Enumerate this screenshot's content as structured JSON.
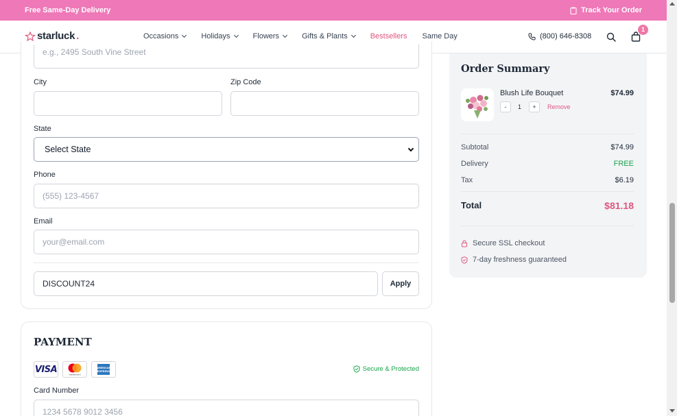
{
  "promo": {
    "left_text": "Free Same-Day Delivery",
    "track_label": "Track Your Order"
  },
  "header": {
    "logo": "starluck",
    "logo_dot": ".",
    "nav": [
      {
        "label": "Occasions",
        "dropdown": true
      },
      {
        "label": "Holidays",
        "dropdown": true
      },
      {
        "label": "Flowers",
        "dropdown": true
      },
      {
        "label": "Gifts & Plants",
        "dropdown": true
      },
      {
        "label": "Bestsellers",
        "dropdown": false,
        "accent": true
      },
      {
        "label": "Same Day",
        "dropdown": false
      }
    ],
    "phone": "(800) 646-8308",
    "cart_count": "1"
  },
  "address": {
    "street_placeholder": "e.g., 2495 South Vine Street",
    "city_label": "City",
    "zip_label": "Zip Code",
    "state_label": "State",
    "state_value": "Select State",
    "phone_label": "Phone",
    "phone_placeholder": "(555) 123-4567",
    "email_label": "Email",
    "email_placeholder": "your@email.com",
    "discount_value": "DISCOUNT24",
    "apply_label": "Apply"
  },
  "payment": {
    "title": "PAYMENT",
    "cards": [
      "visa",
      "mastercard",
      "amex"
    ],
    "visa_text": "VISA",
    "mastercard_text": "mastercard",
    "amex_text": "AMERICAN EXPRESS",
    "secure_label": "Secure & Protected",
    "card_number_label": "Card Number",
    "card_number_placeholder": "1234 5678 9012 3456"
  },
  "summary": {
    "title": "Order Summary",
    "item_name": "Blush Life Bouquet",
    "item_price": "$74.99",
    "qty_minus": "-",
    "qty": "1",
    "qty_plus": "+",
    "remove": "Remove",
    "subtotal_label": "Subtotal",
    "subtotal": "$74.99",
    "delivery_label": "Delivery",
    "delivery": "FREE",
    "tax_label": "Tax",
    "tax": "$6.19",
    "total_label": "Total",
    "total": "$81.18",
    "trust_ssl": "Secure SSL checkout",
    "trust_fresh": "7-day freshness guaranteed"
  },
  "colors": {
    "promo_bg": "#ef78b8",
    "accent": "#e0567f",
    "success": "#16a34a",
    "summary_bg": "#f3f4f6"
  }
}
